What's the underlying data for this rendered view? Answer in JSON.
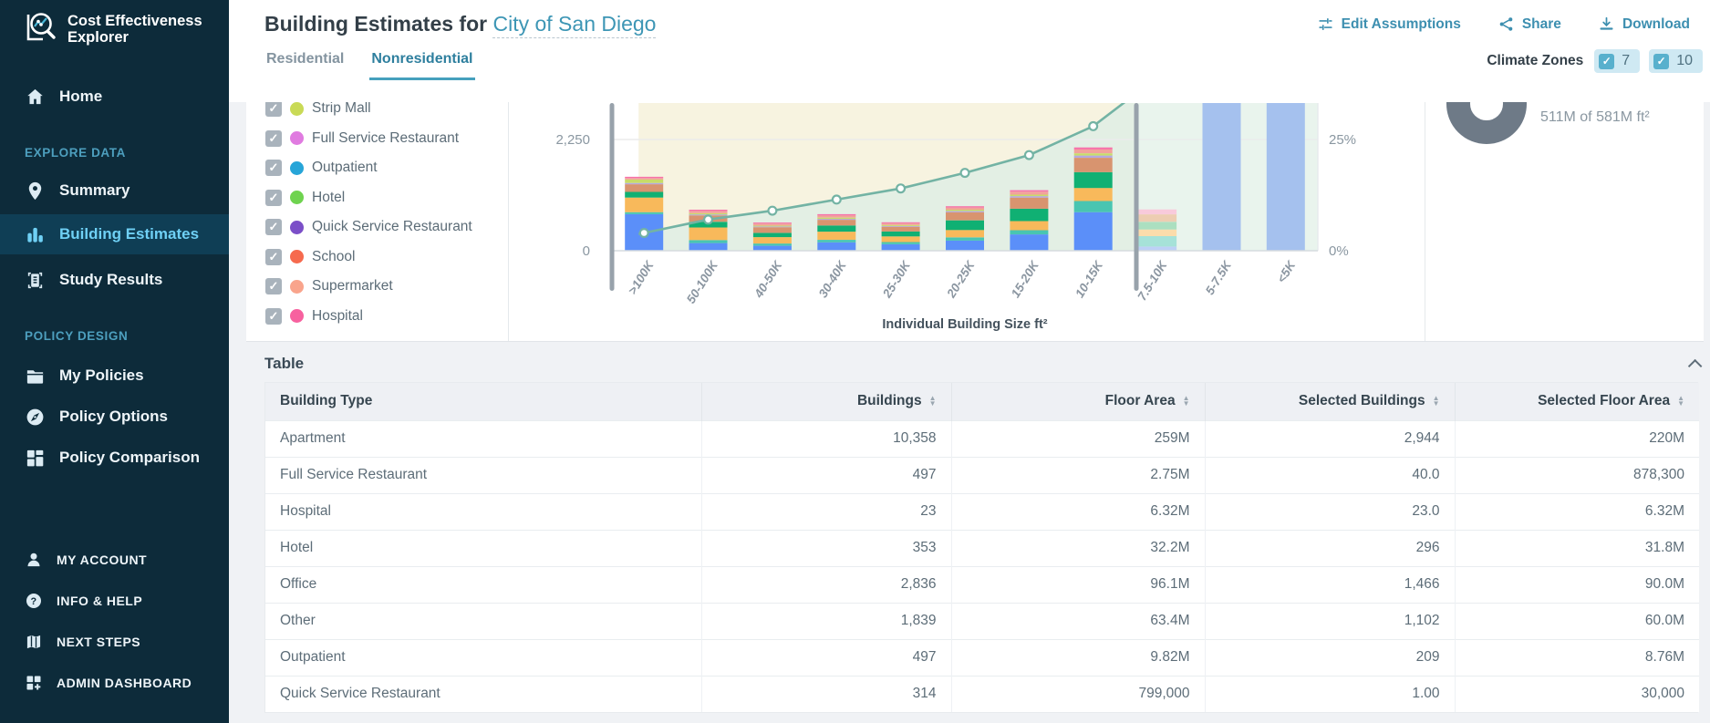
{
  "sidebar": {
    "logo": {
      "line1": "Cost Effectiveness",
      "line2": "Explorer"
    },
    "nav": [
      {
        "type": "item",
        "label": "Home",
        "icon": "home-icon",
        "active": false,
        "extraClass": ""
      },
      {
        "type": "section",
        "label": "EXPLORE DATA"
      },
      {
        "type": "item",
        "label": "Summary",
        "icon": "pin-icon",
        "active": false,
        "extraClass": "m18"
      },
      {
        "type": "item",
        "label": "Building Estimates",
        "icon": "bar-chart-icon",
        "active": true,
        "extraClass": "m10"
      },
      {
        "type": "item",
        "label": "Study Results",
        "icon": "document-icon",
        "active": false,
        "extraClass": "m12"
      },
      {
        "type": "section",
        "label": "POLICY DESIGN"
      },
      {
        "type": "item",
        "label": "My Policies",
        "icon": "folder-icon",
        "active": false,
        "extraClass": "m20"
      },
      {
        "type": "item",
        "label": "Policy Options",
        "icon": "compass-icon",
        "active": false,
        "extraClass": "m13"
      },
      {
        "type": "item",
        "label": "Policy Comparison",
        "icon": "comparison-grid-icon",
        "active": false,
        "extraClass": "m13"
      }
    ],
    "footer_nav": [
      {
        "label": "MY ACCOUNT",
        "icon": "person-icon"
      },
      {
        "label": "INFO & HELP",
        "icon": "help-icon"
      },
      {
        "label": "NEXT STEPS",
        "icon": "map-icon"
      },
      {
        "label": "ADMIN DASHBOARD",
        "icon": "dashboard-plus-icon"
      }
    ]
  },
  "header": {
    "title_prefix": "Building Estimates for",
    "title_region": "City of San Diego",
    "actions": [
      {
        "label": "Edit Assumptions",
        "icon": "sliders-icon"
      },
      {
        "label": "Share",
        "icon": "share-icon"
      },
      {
        "label": "Download",
        "icon": "download-icon"
      }
    ],
    "tabs": [
      {
        "label": "Residential",
        "active": false
      },
      {
        "label": "Nonresidential",
        "active": true
      }
    ],
    "climate_zones": {
      "label": "Climate Zones",
      "zones": [
        {
          "value": "7",
          "checked": true
        },
        {
          "value": "10",
          "checked": true
        }
      ]
    }
  },
  "legend": {
    "items": [
      {
        "label": "Strip Mall",
        "color": "#c9da56",
        "checked": true
      },
      {
        "label": "Full Service Restaurant",
        "color": "#e07be0",
        "checked": true
      },
      {
        "label": "Outpatient",
        "color": "#27a5d8",
        "checked": true
      },
      {
        "label": "Hotel",
        "color": "#6fd34f",
        "checked": true
      },
      {
        "label": "Quick Service Restaurant",
        "color": "#7b4fc8",
        "checked": true
      },
      {
        "label": "School",
        "color": "#f66a4e",
        "checked": true
      },
      {
        "label": "Supermarket",
        "color": "#f9a48c",
        "checked": true
      },
      {
        "label": "Hospital",
        "color": "#f7619f",
        "checked": true
      }
    ]
  },
  "chart_data": {
    "type": "bar",
    "subtype": "stacked-bars-with-cumulative-line-dual-axis",
    "categories": [
      ">100K",
      "50-100K",
      "40-50K",
      "30-40K",
      "25-30K",
      "20-25K",
      "15-20K",
      "10-15K",
      "7.5-10K",
      "5-7.5K",
      "<5K"
    ],
    "xlabel": "Individual Building Size ft²",
    "left_axis": {
      "ticks": [
        "0",
        "2,250"
      ],
      "tick_values": [
        0,
        2250
      ]
    },
    "right_axis": {
      "ticks": [
        "0%",
        "25%"
      ],
      "tick_values": [
        0,
        25
      ]
    },
    "stack_series": [
      {
        "name": "segment-blue",
        "color": "#5b8ff9",
        "values": [
          740,
          155,
          100,
          170,
          130,
          205,
          330,
          780,
          0,
          0,
          0
        ]
      },
      {
        "name": "segment-turquoise",
        "color": "#49c5b1",
        "values": [
          40,
          60,
          45,
          50,
          45,
          65,
          85,
          225,
          0,
          0,
          0
        ]
      },
      {
        "name": "segment-amber",
        "color": "#f8b95b",
        "values": [
          295,
          255,
          130,
          165,
          115,
          150,
          185,
          265,
          0,
          0,
          0
        ]
      },
      {
        "name": "segment-emerald",
        "color": "#10b073",
        "values": [
          115,
          115,
          85,
          125,
          100,
          195,
          250,
          320,
          0,
          0,
          0
        ]
      },
      {
        "name": "segment-tan",
        "color": "#d8946f",
        "values": [
          155,
          130,
          115,
          115,
          95,
          165,
          225,
          290,
          0,
          0,
          0
        ]
      },
      {
        "name": "segment-lavender",
        "color": "#b5a9e0",
        "values": [
          25,
          20,
          15,
          20,
          15,
          25,
          30,
          45,
          0,
          0,
          0
        ]
      },
      {
        "name": "segment-lime",
        "color": "#c8dc68",
        "values": [
          70,
          25,
          20,
          25,
          20,
          25,
          30,
          45,
          0,
          0,
          0
        ]
      },
      {
        "name": "segment-salmon",
        "color": "#f2a29b",
        "values": [
          30,
          45,
          40,
          45,
          35,
          45,
          60,
          80,
          0,
          0,
          0
        ]
      },
      {
        "name": "segment-pink",
        "color": "#f772a9",
        "values": [
          25,
          25,
          20,
          25,
          20,
          25,
          30,
          40,
          0,
          0,
          0
        ]
      },
      {
        "name": "segment-faded-blue",
        "color": "#bdd0f6",
        "values": [
          0,
          0,
          0,
          0,
          0,
          0,
          0,
          0,
          85,
          0,
          0
        ]
      },
      {
        "name": "segment-faded-teal",
        "color": "#a6e2d8",
        "values": [
          0,
          0,
          0,
          0,
          0,
          0,
          0,
          0,
          210,
          0,
          0
        ]
      },
      {
        "name": "segment-faded-yellow",
        "color": "#fbdcab",
        "values": [
          0,
          0,
          0,
          0,
          0,
          0,
          0,
          0,
          135,
          0,
          0
        ]
      },
      {
        "name": "segment-faded-green",
        "color": "#abdfc0",
        "values": [
          0,
          0,
          0,
          0,
          0,
          0,
          0,
          0,
          155,
          0,
          0
        ]
      },
      {
        "name": "segment-faded-tan",
        "color": "#edcdb2",
        "values": [
          0,
          0,
          0,
          0,
          0,
          0,
          0,
          0,
          150,
          0,
          0
        ]
      },
      {
        "name": "segment-faded-pink",
        "color": "#f8cadb",
        "values": [
          0,
          0,
          0,
          0,
          0,
          0,
          0,
          0,
          100,
          0,
          0
        ]
      },
      {
        "name": "segment-unselected-overflow",
        "color": "#a5c1ee",
        "values": [
          0,
          0,
          0,
          0,
          0,
          0,
          0,
          0,
          0,
          3200,
          3200
        ]
      }
    ],
    "line_series": {
      "name": "cumulative-share",
      "axis": "right",
      "color": "#73b3a4",
      "values_pct": [
        4,
        7,
        9,
        11.5,
        14,
        17.5,
        21.5,
        28,
        39,
        null,
        null
      ]
    },
    "brush_selection": {
      "from": ">100K",
      "to": "10-15K",
      "handle_color": "#98a2ab"
    },
    "regions": {
      "above_line": "#f7f3e0",
      "below_line": "#e3efe4",
      "unselected_band": "#e9f4ed"
    },
    "grid": true,
    "legend_position": "left"
  },
  "donut": {
    "caption": "511M of 581M ft²",
    "ring_color": "#6e7a87"
  },
  "table": {
    "section_label": "Table",
    "columns": [
      {
        "label": "Building Type",
        "sortable": true,
        "numeric": false
      },
      {
        "label": "Buildings",
        "sortable": true,
        "numeric": true
      },
      {
        "label": "Floor Area",
        "sortable": true,
        "numeric": true
      },
      {
        "label": "Selected Buildings",
        "sortable": true,
        "numeric": true
      },
      {
        "label": "Selected Floor Area",
        "sortable": true,
        "numeric": true
      }
    ],
    "rows": [
      [
        "Apartment",
        "10,358",
        "259M",
        "2,944",
        "220M"
      ],
      [
        "Full Service Restaurant",
        "497",
        "2.75M",
        "40.0",
        "878,300"
      ],
      [
        "Hospital",
        "23",
        "6.32M",
        "23.0",
        "6.32M"
      ],
      [
        "Hotel",
        "353",
        "32.2M",
        "296",
        "31.8M"
      ],
      [
        "Office",
        "2,836",
        "96.1M",
        "1,466",
        "90.0M"
      ],
      [
        "Other",
        "1,839",
        "63.4M",
        "1,102",
        "60.0M"
      ],
      [
        "Outpatient",
        "497",
        "9.82M",
        "209",
        "8.76M"
      ],
      [
        "Quick Service Restaurant",
        "314",
        "799,000",
        "1.00",
        "30,000"
      ]
    ]
  },
  "colors": {
    "accent_teal": "#3d8fb0",
    "sidebar_bg": "#0d2b3a",
    "active_item": "#6fd0f5"
  }
}
